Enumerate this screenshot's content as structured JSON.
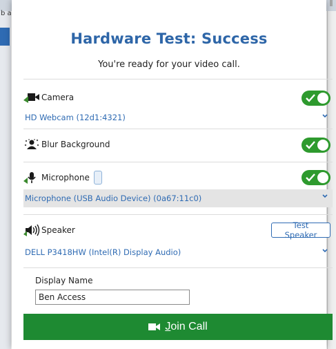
{
  "background": {
    "left_text": "b a"
  },
  "modal": {
    "title": "Hardware Test: Success",
    "subtitle": "You're ready for your video call."
  },
  "camera": {
    "label": "Camera",
    "icon": "camera-icon",
    "enabled": true,
    "device": "HD Webcam (12d1:4321)"
  },
  "blur": {
    "label": "Blur Background",
    "icon": "blur-icon",
    "enabled": true
  },
  "microphone": {
    "label": "Microphone",
    "icon": "microphone-icon",
    "enabled": true,
    "device": "Microphone (USB Audio Device) (0a67:11c0)"
  },
  "speaker": {
    "label": "Speaker",
    "icon": "speaker-icon",
    "test_button": "Test Speaker",
    "device": "DELL P3418HW (Intel(R) Display Audio)"
  },
  "display_name": {
    "label": "Display Name",
    "value": "Ben Access"
  },
  "join": {
    "label_first": "J",
    "label_rest": "oin Call",
    "icon": "video-camera-icon"
  },
  "colors": {
    "title": "#2e66a8",
    "link": "#2f6bb3",
    "toggle_on": "#2e9a2e",
    "join_button": "#1e8a32"
  }
}
